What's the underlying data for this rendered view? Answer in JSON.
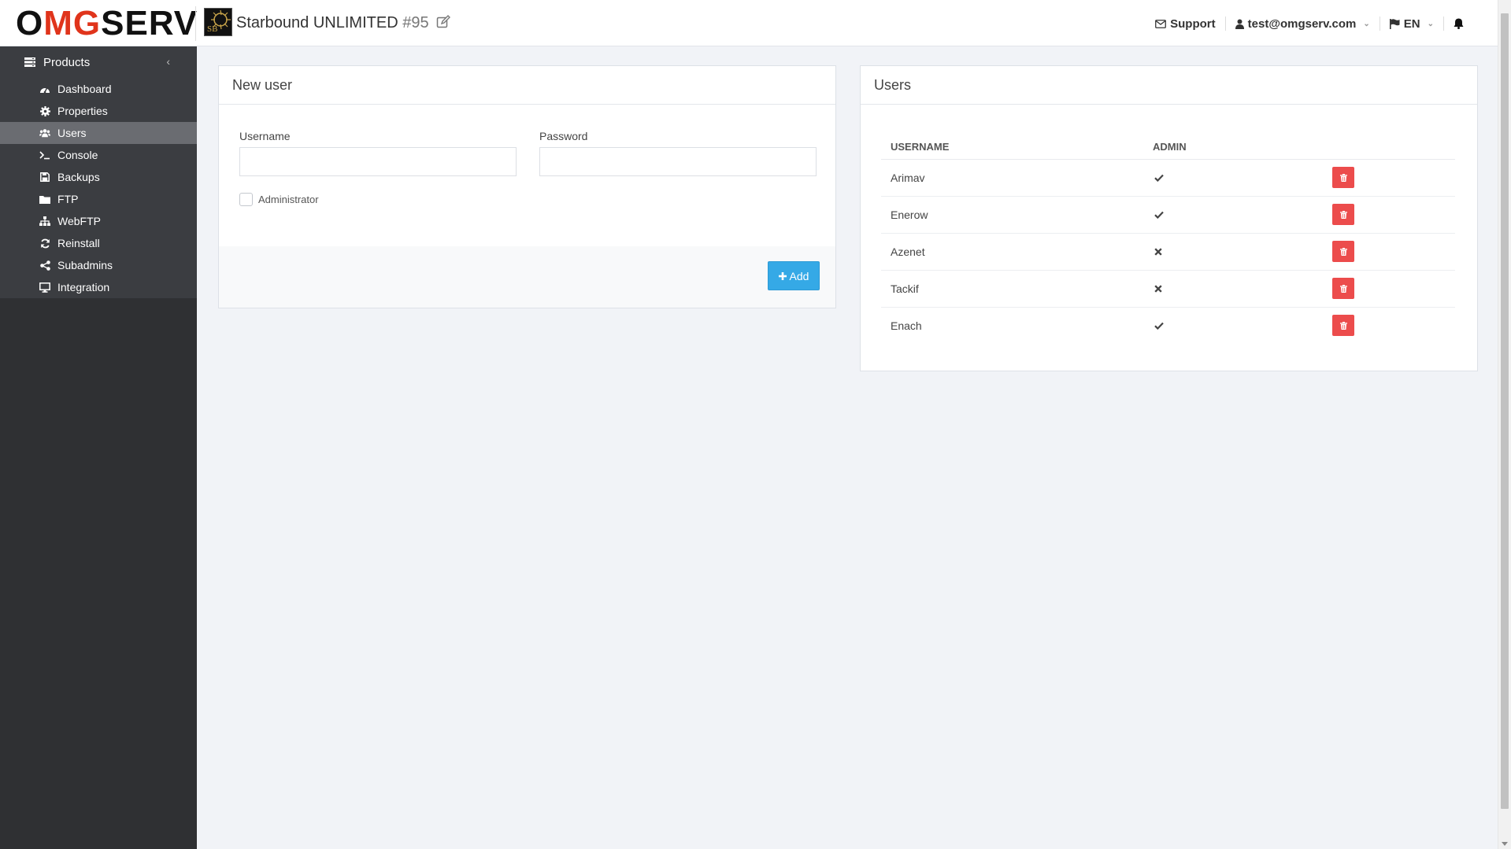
{
  "header": {
    "logo": {
      "o": "O",
      "mg": "MG",
      "serv": "SERV"
    },
    "product_thumb_text": "SB",
    "product_name": "Starbound UNLIMITED",
    "product_number": "#95",
    "support_label": "Support",
    "user_email": "test@omgserv.com",
    "language": "EN"
  },
  "sidebar": {
    "title": "Products",
    "items": [
      {
        "label": "Dashboard",
        "icon": "dashboard-icon",
        "active": false
      },
      {
        "label": "Properties",
        "icon": "gear-icon",
        "active": false
      },
      {
        "label": "Users",
        "icon": "users-icon",
        "active": true
      },
      {
        "label": "Console",
        "icon": "terminal-icon",
        "active": false
      },
      {
        "label": "Backups",
        "icon": "save-icon",
        "active": false
      },
      {
        "label": "FTP",
        "icon": "folder-icon",
        "active": false
      },
      {
        "label": "WebFTP",
        "icon": "sitemap-icon",
        "active": false
      },
      {
        "label": "Reinstall",
        "icon": "refresh-icon",
        "active": false
      },
      {
        "label": "Subadmins",
        "icon": "share-icon",
        "active": false
      },
      {
        "label": "Integration",
        "icon": "desktop-icon",
        "active": false
      }
    ]
  },
  "new_user": {
    "title": "New user",
    "username_label": "Username",
    "username_value": "",
    "password_label": "Password",
    "password_value": "",
    "admin_label": "Administrator",
    "admin_checked": false,
    "add_label": "Add"
  },
  "users": {
    "title": "Users",
    "columns": [
      "USERNAME",
      "ADMIN"
    ],
    "rows": [
      {
        "username": "Arimav",
        "admin": true
      },
      {
        "username": "Enerow",
        "admin": true
      },
      {
        "username": "Azenet",
        "admin": false
      },
      {
        "username": "Tackif",
        "admin": false
      },
      {
        "username": "Enach",
        "admin": true
      }
    ]
  },
  "colors": {
    "accent": "#35a9e6",
    "danger": "#ec4c4c",
    "brand_red": "#e0341b",
    "sidebar_bg": "#2f3033",
    "sidebar_active": "#6a6c71"
  }
}
